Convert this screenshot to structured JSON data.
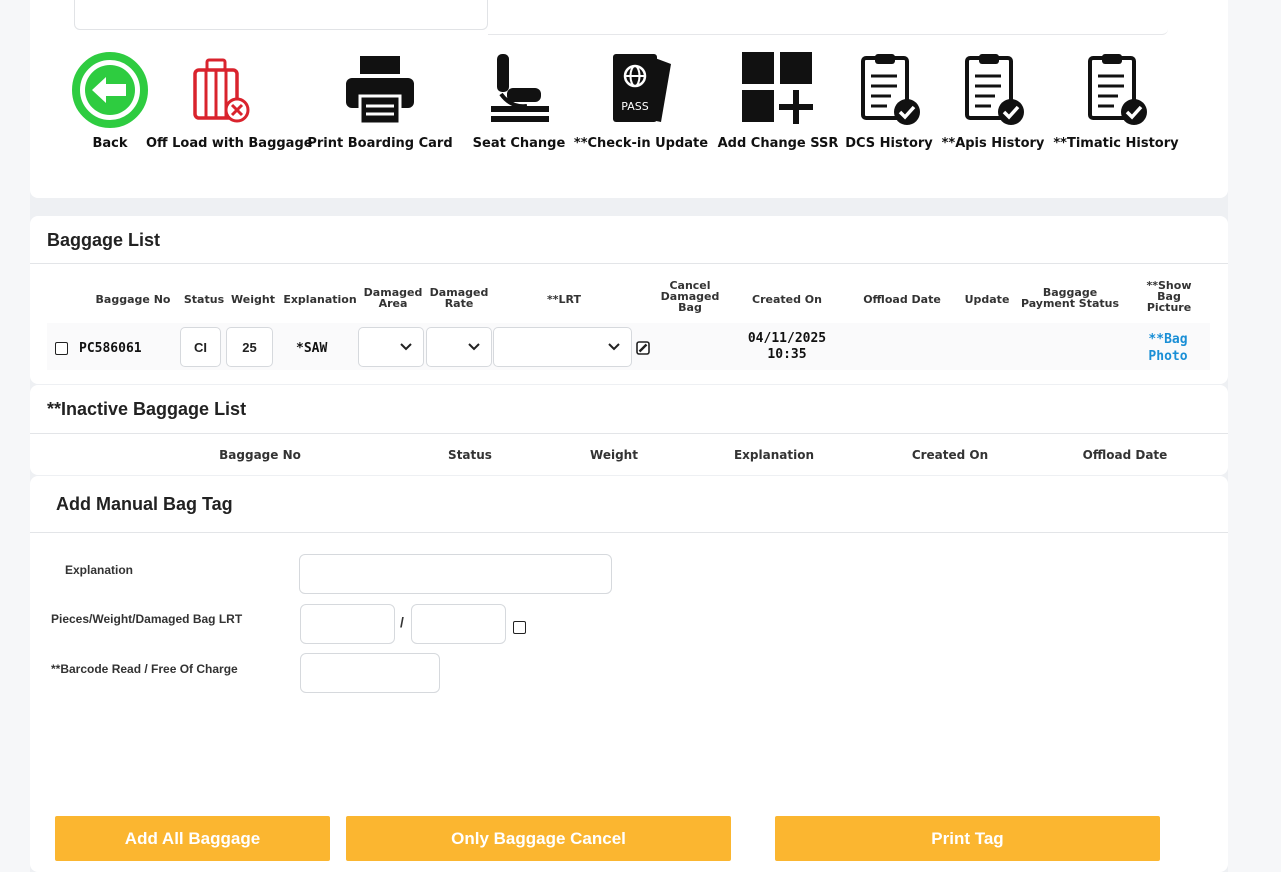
{
  "toolbar": {
    "back": "Back",
    "offload": "Off Load with Baggage",
    "print_boarding": "Print Boarding Card",
    "seat_change": "Seat Change",
    "checkin_update": "**Check-in Update",
    "add_ssr": "Add Change SSR",
    "dcs_history": "DCS History",
    "apis_history": "**Apis History",
    "timatic_history": "**Timatic History",
    "pass_text": "PASS"
  },
  "baggage_list": {
    "title": "Baggage List",
    "headers": {
      "baggage_no": "Baggage No",
      "status": "Status",
      "weight": "Weight",
      "explanation": "Explanation",
      "damaged_area_1": "Damaged",
      "damaged_area_2": "Area",
      "damaged_rate_1": "Damaged",
      "damaged_rate_2": "Rate",
      "lrt": "**LRT",
      "cancel_1": "Cancel",
      "cancel_2": "Damaged",
      "cancel_3": "Bag",
      "created_on": "Created On",
      "offload_date": "Offload Date",
      "update": "Update",
      "payment_1": "Baggage",
      "payment_2": "Payment Status",
      "show_1": "**Show",
      "show_2": "Bag",
      "show_3": "Picture"
    },
    "row": {
      "baggage_no": "PC586061",
      "status": "CI",
      "weight": "25",
      "explanation": "*SAW",
      "created_date": "04/11/2025",
      "created_time": "10:35",
      "photo_1": "**Bag",
      "photo_2": "Photo"
    }
  },
  "inactive": {
    "title": "**Inactive Baggage List",
    "headers": {
      "baggage_no": "Baggage No",
      "status": "Status",
      "weight": "Weight",
      "explanation": "Explanation",
      "created_on": "Created On",
      "offload_date": "Offload Date"
    }
  },
  "manual": {
    "title": "Add Manual Bag Tag",
    "explanation_label": "Explanation",
    "pieces_label": "Pieces/Weight/Damaged Bag LRT",
    "slash": "/",
    "barcode_label": "**Barcode Read / Free Of Charge"
  },
  "buttons": {
    "add_all": "Add All Baggage",
    "only_cancel": "Only Baggage Cancel",
    "print_tag": "Print Tag"
  },
  "colors": {
    "accent_button": "#fbb630",
    "back_icon": "#2ecc40",
    "offload_icon": "#d9232d",
    "link": "#1a8fd6"
  }
}
